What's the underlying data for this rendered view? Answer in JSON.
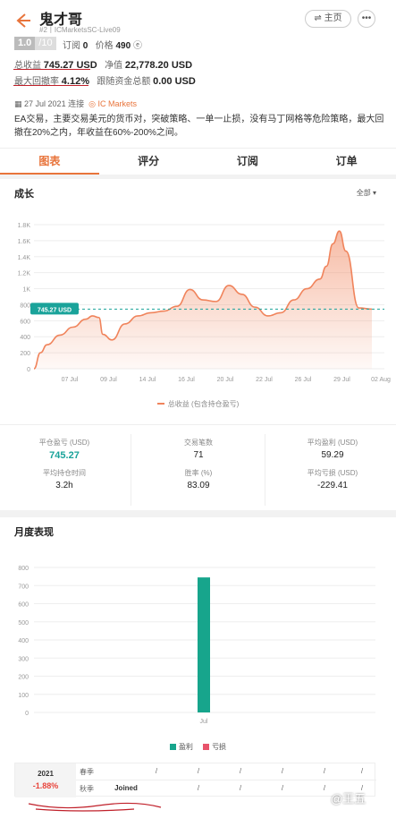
{
  "header": {
    "back_icon": "arrow-left-icon",
    "title": "鬼才哥",
    "subtitle": "#2丨ICMarketsSC-Live09",
    "home_label": "⇌ 主页",
    "more_label": "•••",
    "rating_value": "1.0",
    "rating_max": "/10",
    "subscribe_label": "订阅",
    "subscribe_value": "0",
    "price_label": "价格",
    "price_value": "490",
    "price_icon": "ⓔ",
    "total_profit_label": "总收益",
    "total_profit_value": "745.27 USD",
    "net_label": "净值",
    "net_value": "22,778.20 USD",
    "drawdown_label": "最大回撤率",
    "drawdown_value": "4.12%",
    "follow_label": "跟随资金总额",
    "follow_value": "0.00 USD",
    "date_icon": "calendar-icon",
    "date_text": "27 Jul 2021 连接",
    "broker": "IC Markets",
    "description": "EA交易，主要交易美元的货币对，突破策略、一单一止损，没有马丁网格等危险策略，最大回撤在20%之内，年收益在60%-200%之间。"
  },
  "tabs": [
    "图表",
    "评分",
    "订阅",
    "订单"
  ],
  "growth": {
    "title": "成长",
    "filter": "全部 ▾",
    "legend": "总收益 (包含持仓盈亏)",
    "line_color": "#f0845c",
    "baseline_label": "745.27 USD"
  },
  "chart_data": [
    {
      "type": "area",
      "title": "成长",
      "y_ticks": [
        "0",
        "200",
        "400",
        "600",
        "800",
        "1K",
        "1.2K",
        "1.4K",
        "1.6K",
        "1.8K"
      ],
      "x_ticks": [
        "07 Jul",
        "09 Jul",
        "14 Jul",
        "16 Jul",
        "20 Jul",
        "22 Jul",
        "26 Jul",
        "29 Jul",
        "02 Aug"
      ],
      "ylim": [
        0,
        1800
      ],
      "reference_line": 745.27,
      "series": [
        {
          "name": "总收益 (包含持仓盈亏)",
          "x": [
            0,
            0.5,
            1,
            2,
            3,
            4,
            4.5,
            5,
            5.3,
            6,
            7,
            8,
            9,
            10,
            11,
            12,
            13,
            14,
            15,
            16,
            17,
            18,
            19,
            20,
            21,
            22,
            22.5,
            23,
            23.5,
            24,
            25,
            26
          ],
          "values": [
            0,
            200,
            300,
            420,
            520,
            620,
            660,
            640,
            430,
            360,
            560,
            660,
            700,
            720,
            780,
            990,
            860,
            840,
            1040,
            930,
            770,
            660,
            700,
            860,
            1000,
            1120,
            1280,
            1560,
            1720,
            1470,
            760,
            745
          ]
        }
      ]
    },
    {
      "type": "bar",
      "title": "月度表现",
      "categories": [
        "Jul"
      ],
      "y_ticks": [
        "0",
        "100",
        "200",
        "300",
        "400",
        "500",
        "600",
        "700",
        "800"
      ],
      "ylim": [
        0,
        800
      ],
      "series": [
        {
          "name": "盈利",
          "values": [
            745
          ]
        },
        {
          "name": "亏损",
          "values": [
            0
          ]
        }
      ]
    }
  ],
  "stats": [
    {
      "label": "平仓盈亏 (USD)",
      "value": "745.27",
      "highlight": true
    },
    {
      "label": "交易笔数",
      "value": "71"
    },
    {
      "label": "平均盈利 (USD)",
      "value": "59.29"
    },
    {
      "label": "平均持仓时间",
      "value": "3.2h"
    },
    {
      "label": "胜率 (%)",
      "value": "83.09"
    },
    {
      "label": "平均亏损 (USD)",
      "value": "-229.41"
    }
  ],
  "monthly": {
    "title": "月度表现",
    "profit_label": "盈利",
    "loss_label": "亏损",
    "profit_color": "#17a58c",
    "loss_color": "#e8536b",
    "year": "2021",
    "year_pct": "-1.88%",
    "row1_label": "春季",
    "row2_label": "秋季",
    "row2_first": "Joined",
    "empty": "/"
  },
  "watermark": "@王五"
}
